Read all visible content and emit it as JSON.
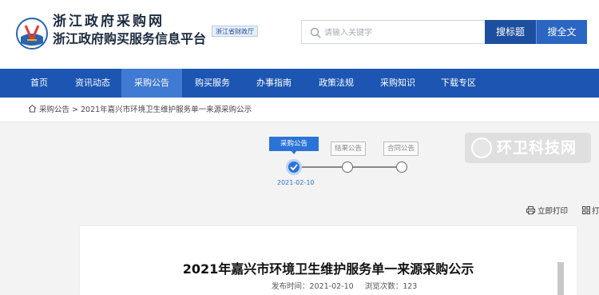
{
  "header": {
    "site_title": "浙江政府采购网",
    "site_subtitle": "浙江政府购买服务信息平台",
    "dept_badge": "浙江省财政厅",
    "logo_icon": "zhejiang-procurement-logo"
  },
  "search": {
    "placeholder": "请输入关键字",
    "btn_title": "搜标题",
    "btn_full": "搜全文"
  },
  "nav": {
    "items": [
      {
        "label": "首页",
        "active": false
      },
      {
        "label": "资讯动态",
        "active": false
      },
      {
        "label": "采购公告",
        "active": true
      },
      {
        "label": "购买服务",
        "active": false
      },
      {
        "label": "办事指南",
        "active": false
      },
      {
        "label": "政策法规",
        "active": false
      },
      {
        "label": "采购知识",
        "active": false
      },
      {
        "label": "下载专区",
        "active": false
      }
    ]
  },
  "breadcrumb": {
    "text": "采购公告 > 2021年嘉兴市环境卫生维护服务单一来源采购公示"
  },
  "stepper": {
    "steps": [
      {
        "label": "采购公告",
        "state": "done"
      },
      {
        "label": "结果公告",
        "state": "pending"
      },
      {
        "label": "合同公告",
        "state": "pending"
      }
    ],
    "date": "2021-02-10"
  },
  "watermark": {
    "text": "环卫科技网"
  },
  "tools": {
    "print_label": "立即打印",
    "extra_label": "打"
  },
  "document": {
    "title": "2021年嘉兴市环境卫生维护服务单一来源采购公示",
    "publish_time": "发布时间：2021-02-10",
    "views": "浏览次数：123"
  },
  "colors": {
    "nav_bg": "#1c56b2",
    "nav_active": "#3f7ad3",
    "accent": "#2b73d9",
    "btn_primary": "#1d4f9f"
  }
}
